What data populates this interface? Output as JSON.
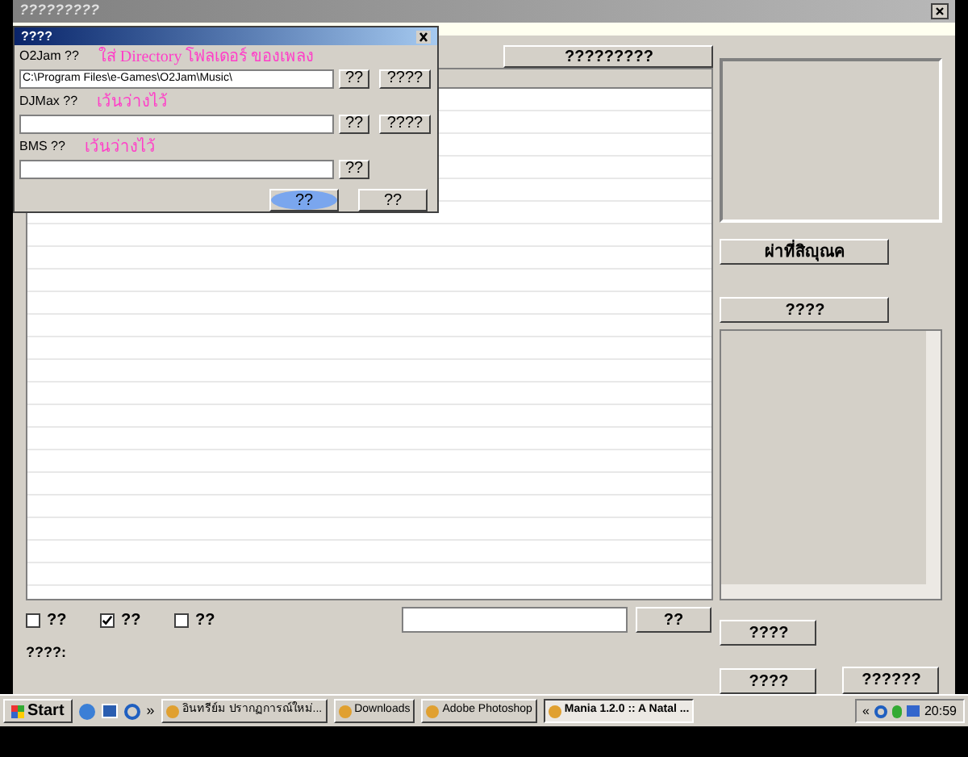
{
  "window": {
    "title": "?????????",
    "tab_button": "?????????"
  },
  "right_panel": {
    "buttons": [
      "ผ่าที่สิญุณค",
      "????"
    ]
  },
  "options": [
    {
      "label": "??",
      "checked": false
    },
    {
      "label": "??",
      "checked": true
    },
    {
      "label": "??",
      "checked": false
    }
  ],
  "bottom": {
    "send_button": "??",
    "status_label": "????:",
    "side_buttons": [
      "????",
      "????"
    ],
    "corner_button": "??????"
  },
  "dialog": {
    "title": "????",
    "rows": [
      {
        "label": "O2Jam ??",
        "note": "ใส่ Directory โฟลเดอร์ ของเพลง",
        "value": "C:\\Program Files\\e-Games\\O2Jam\\Music\\",
        "buttons": [
          "??",
          "????"
        ]
      },
      {
        "label": "DJMax ??",
        "note": "เว้นว่างไว้",
        "buttons": [
          "??",
          "????"
        ]
      },
      {
        "label": "BMS ??",
        "note": "เว้นว่างไว้",
        "buttons": [
          "??"
        ]
      }
    ],
    "ok_button": "??",
    "cancel_button": "??"
  },
  "taskbar": {
    "start": "Start",
    "more": "»",
    "tasks": [
      {
        "label": "อินทรีย์ม ปรากฏการณ์ใหม่...",
        "selected": false
      },
      {
        "label": "Downloads",
        "selected": false
      },
      {
        "label": "Adobe Photoshop",
        "selected": false
      },
      {
        "label": "Mania 1.2.0 :: A Natal ...",
        "selected": true
      }
    ],
    "tray_more": "«",
    "clock": "20:59"
  }
}
